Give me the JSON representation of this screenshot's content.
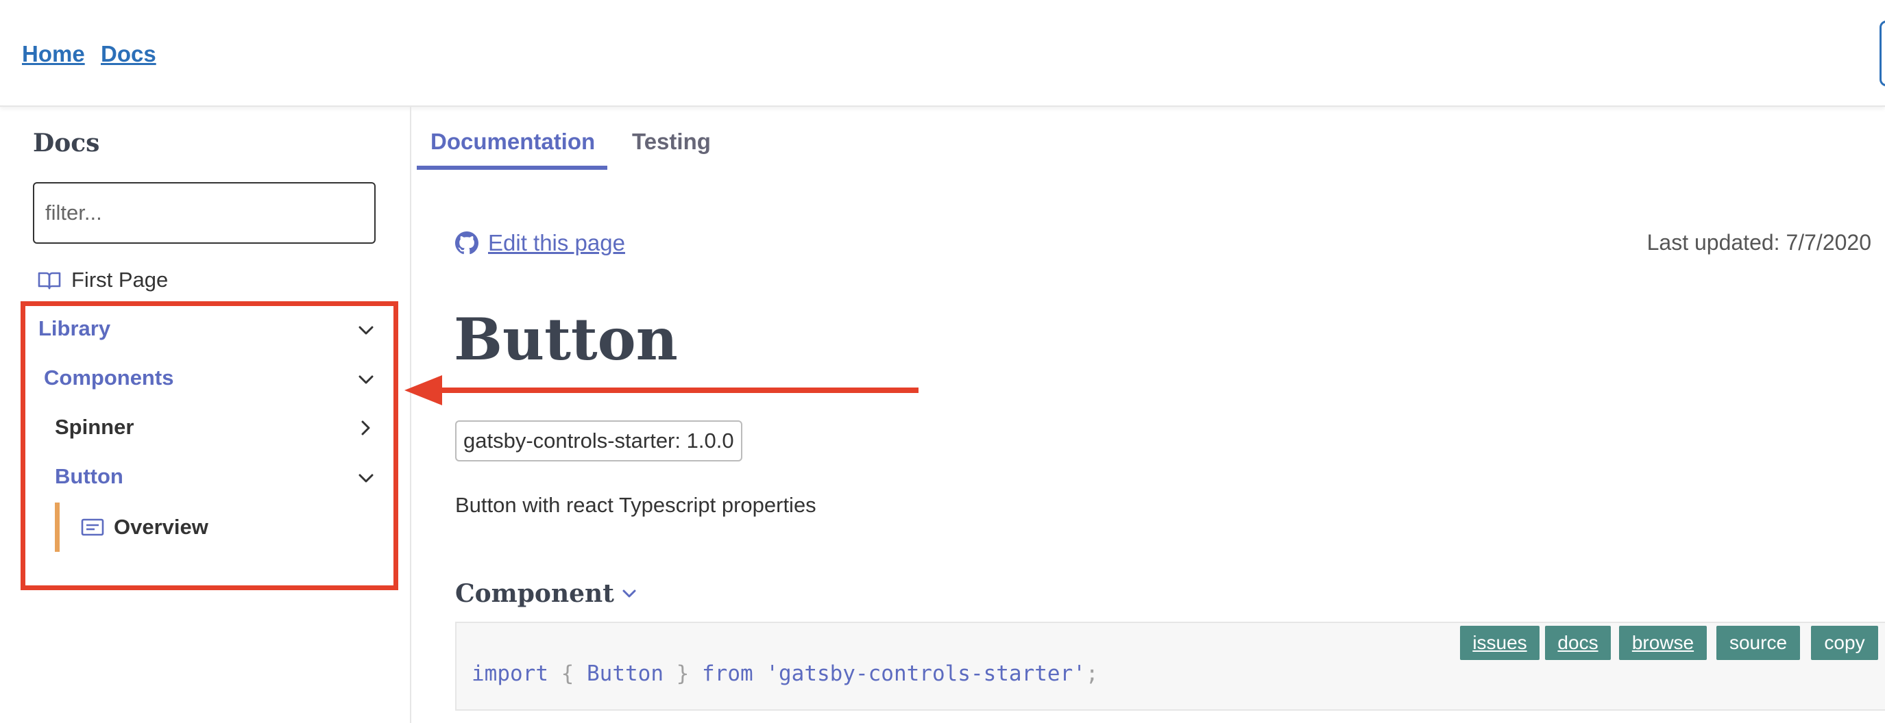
{
  "header": {
    "links": [
      "Home",
      "Docs"
    ]
  },
  "sidebar": {
    "title": "Docs",
    "filter": {
      "placeholder": "filter...",
      "value": ""
    },
    "first_page": {
      "label": "First Page",
      "icon": "book-open-icon"
    },
    "tree": {
      "library": {
        "label": "Library",
        "expanded": true
      },
      "components": {
        "label": "Components",
        "expanded": true
      },
      "spinner": {
        "label": "Spinner",
        "expanded": false
      },
      "button": {
        "label": "Button",
        "expanded": true
      },
      "overview": {
        "label": "Overview",
        "icon": "document-lines-icon",
        "active": true
      }
    }
  },
  "tabs": [
    {
      "label": "Documentation",
      "active": true
    },
    {
      "label": "Testing",
      "active": false
    }
  ],
  "page": {
    "edit_link": "Edit this page",
    "last_updated": "Last updated: 7/7/2020",
    "title": "Button",
    "version_badge": "gatsby-controls-starter: 1.0.0",
    "description": "Button with react Typescript properties",
    "section_title": "Component",
    "code": {
      "tokens": {
        "kw_import": "import",
        "brace_open": "{",
        "name": "Button",
        "brace_close": "}",
        "kw_from": "from",
        "module": "'gatsby-controls-starter'",
        "semicolon": ";"
      },
      "buttons": [
        "issues",
        "docs",
        "browse",
        "source",
        "copy"
      ]
    }
  },
  "colors": {
    "accent": "#5c6bc0",
    "link": "#2b6fb8",
    "heading": "#3d4451",
    "annotation_red": "#e5402a",
    "active_bar": "#e8a25a",
    "code_button": "#4c8b84"
  }
}
